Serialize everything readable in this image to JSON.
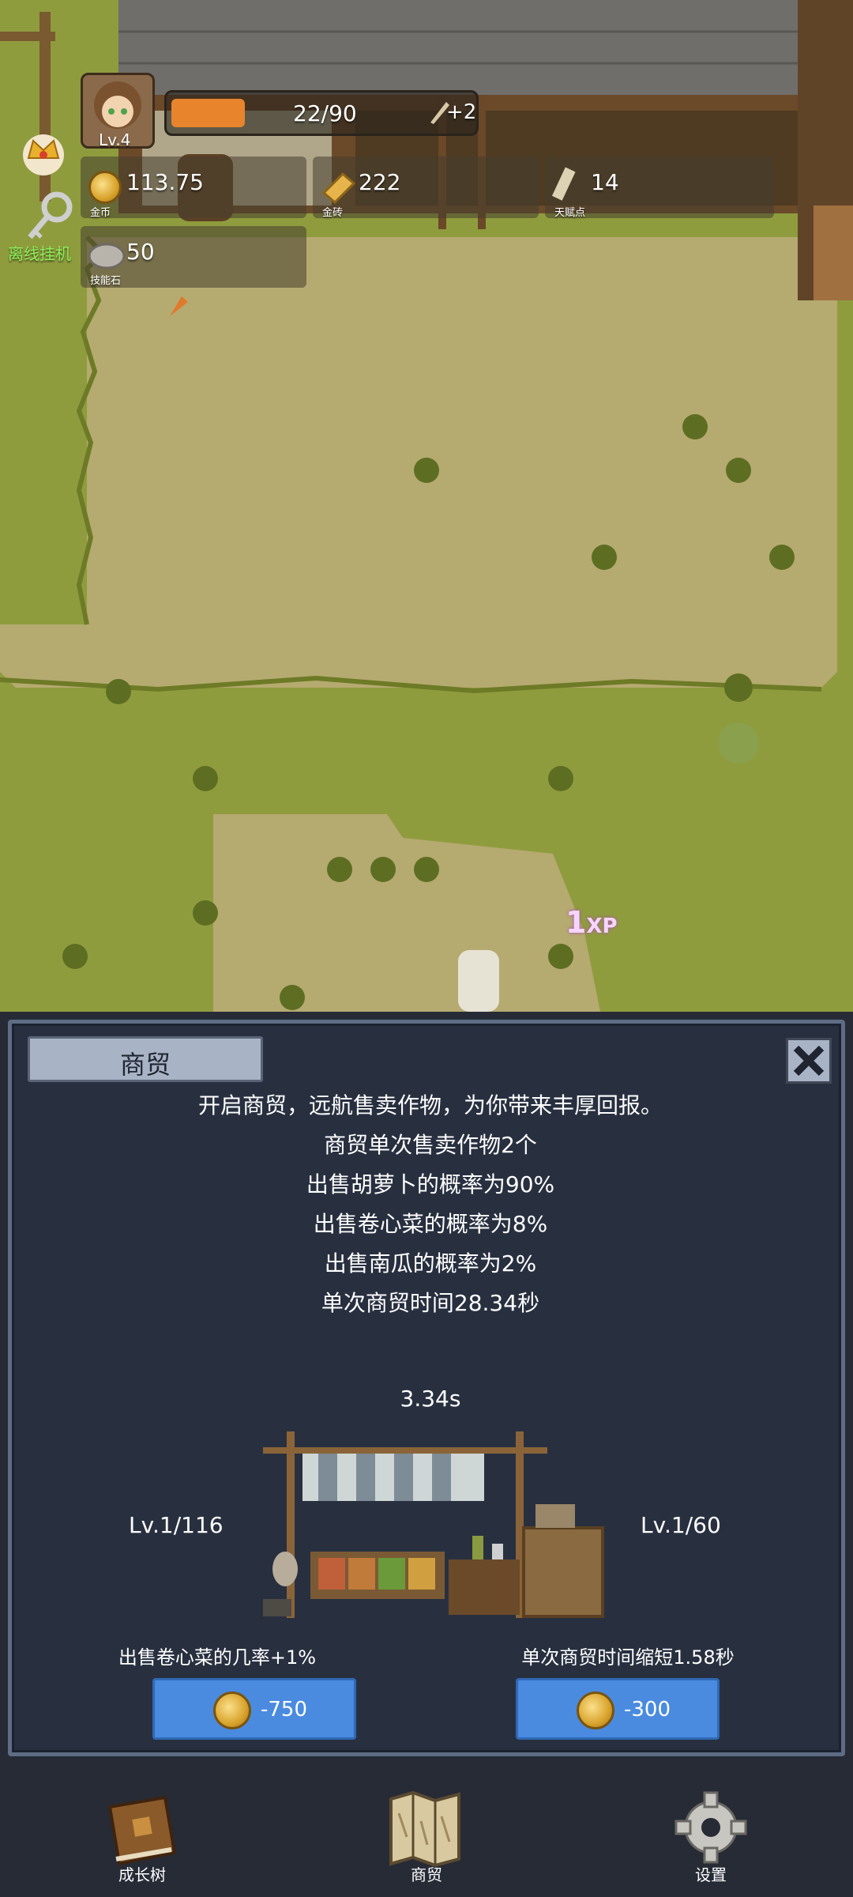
{
  "player": {
    "level": "Lv.4",
    "xp_text": "22/90",
    "xp_fraction": 0.244,
    "talent_bonus": "+2"
  },
  "resources": [
    {
      "icon": "gold-coin-icon",
      "value": "113.75",
      "label": "金币"
    },
    {
      "icon": "gold-brick-icon",
      "value": "222",
      "label": "金砖"
    },
    {
      "icon": "talent-scroll-icon",
      "value": "14",
      "label": "天赋点"
    },
    {
      "icon": "skill-stone-icon",
      "value": "50",
      "label": "技能石"
    }
  ],
  "idle_label": "离线挂机",
  "xp_popup": {
    "amount": "1",
    "unit": "XP"
  },
  "panel": {
    "title": "商贸",
    "lines": [
      "开启商贸，远航售卖作物，为你带来丰厚回报。",
      "商贸单次售卖作物2个",
      "出售胡萝卜的概率为90%",
      "出售卷心菜的概率为8%",
      "出售南瓜的概率为2%",
      "单次商贸时间28.34秒"
    ],
    "timer": "3.34s",
    "left_upgrade": {
      "level": "Lv.1/116",
      "desc": "出售卷心菜的几率+1%",
      "cost": "-750"
    },
    "right_upgrade": {
      "level": "Lv.1/60",
      "desc": "单次商贸时间缩短1.58秒",
      "cost": "-300"
    }
  },
  "nav": [
    {
      "label": "成长树",
      "icon": "book-icon"
    },
    {
      "label": "商贸",
      "icon": "map-icon"
    },
    {
      "label": "设置",
      "icon": "gear-icon"
    }
  ],
  "colors": {
    "grass": "#8c9a3c",
    "dirt": "#b3a86e",
    "panel_bg": "#283040",
    "button_blue": "#4a8be0",
    "xp_orange": "#e8842c"
  }
}
